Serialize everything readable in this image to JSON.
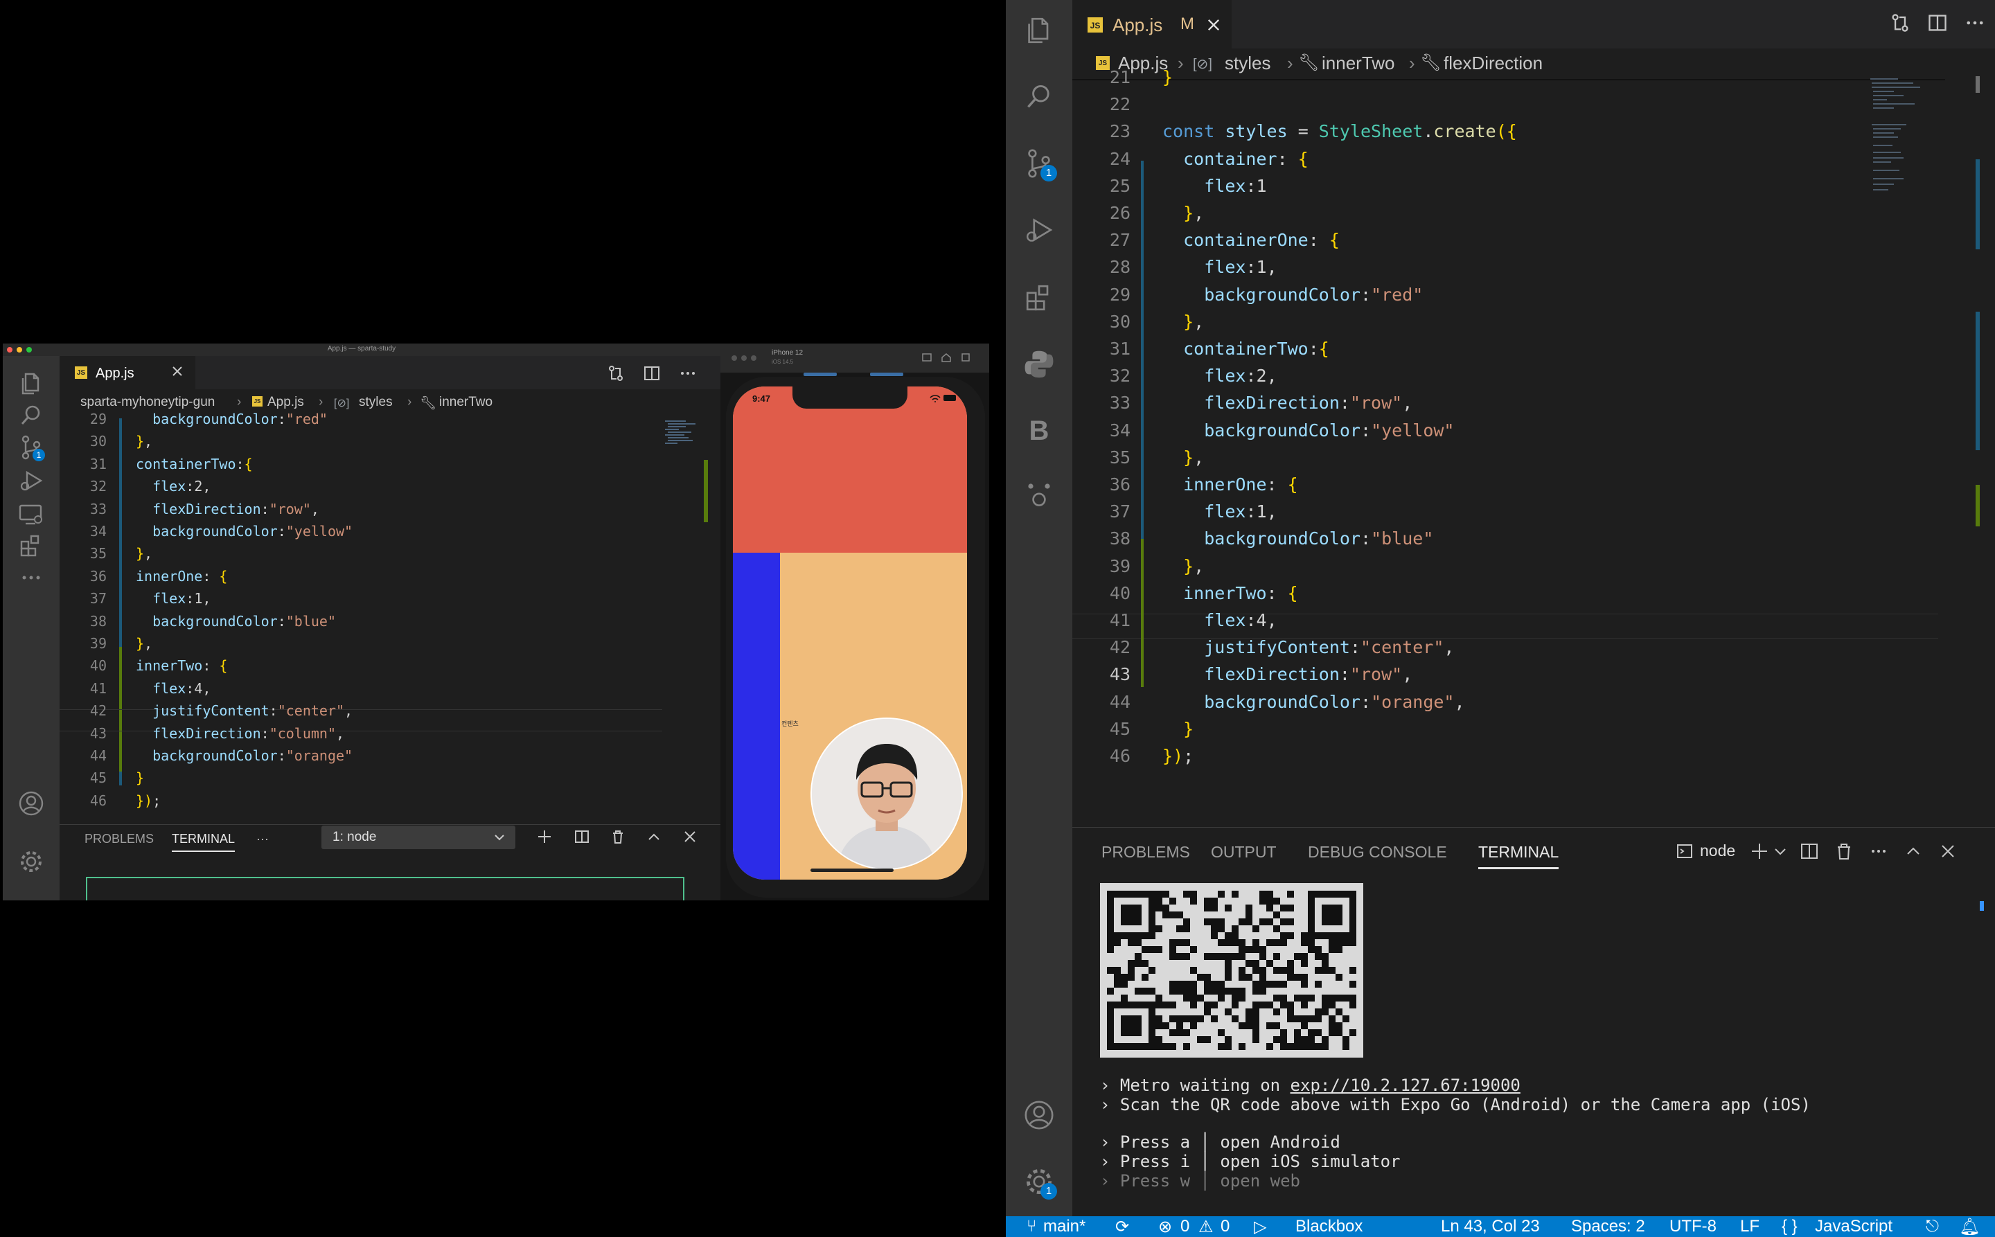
{
  "left_window": {
    "title": "App.js — sparta-study",
    "tab_label": "App.js",
    "breadcrumb": [
      "sparta-myhoneytip-gun",
      "App.js",
      "styles",
      "innerTwo"
    ],
    "code_lines": [
      {
        "n": "29",
        "t": "  backgroundColor:\"red\""
      },
      {
        "n": "30",
        "t": "},"
      },
      {
        "n": "31",
        "t": "containerTwo:{"
      },
      {
        "n": "32",
        "t": "  flex:2,"
      },
      {
        "n": "33",
        "t": "  flexDirection:\"row\","
      },
      {
        "n": "34",
        "t": "  backgroundColor:\"yellow\""
      },
      {
        "n": "35",
        "t": "},"
      },
      {
        "n": "36",
        "t": "innerOne: {"
      },
      {
        "n": "37",
        "t": "  flex:1,"
      },
      {
        "n": "38",
        "t": "  backgroundColor:\"blue\""
      },
      {
        "n": "39",
        "t": "},"
      },
      {
        "n": "40",
        "t": "innerTwo: {"
      },
      {
        "n": "41",
        "t": "  flex:4,"
      },
      {
        "n": "42",
        "t": "  justifyContent:\"center\","
      },
      {
        "n": "43",
        "t": "  flexDirection:\"column\","
      },
      {
        "n": "44",
        "t": "  backgroundColor:\"orange\""
      },
      {
        "n": "45",
        "t": "}"
      },
      {
        "n": "46",
        "t": "});"
      }
    ],
    "panel_tabs": {
      "problems": "PROBLEMS",
      "terminal": "TERMINAL",
      "more": "···"
    },
    "terminal_select": "1: node",
    "source_control_badge": "1"
  },
  "simulator": {
    "device": "iPhone 12",
    "os": "iOS 14.5",
    "time": "9:47",
    "text": "컨텐츠",
    "colors": {
      "top": "#e05c4a",
      "left": "#2c2ce8",
      "right": "#f0bc7b"
    }
  },
  "right_window": {
    "tab_label": "App.js",
    "tab_modified": "M",
    "breadcrumb": [
      "App.js",
      "styles",
      "innerTwo",
      "flexDirection"
    ],
    "code_lines": [
      {
        "n": "21",
        "t": "}"
      },
      {
        "n": "22",
        "t": ""
      },
      {
        "n": "23",
        "t": "const styles = StyleSheet.create({"
      },
      {
        "n": "24",
        "t": "  container: {"
      },
      {
        "n": "25",
        "t": "    flex:1"
      },
      {
        "n": "26",
        "t": "  },"
      },
      {
        "n": "27",
        "t": "  containerOne: {"
      },
      {
        "n": "28",
        "t": "    flex:1,"
      },
      {
        "n": "29",
        "t": "    backgroundColor:\"red\""
      },
      {
        "n": "30",
        "t": "  },"
      },
      {
        "n": "31",
        "t": "  containerTwo:{"
      },
      {
        "n": "32",
        "t": "    flex:2,"
      },
      {
        "n": "33",
        "t": "    flexDirection:\"row\","
      },
      {
        "n": "34",
        "t": "    backgroundColor:\"yellow\""
      },
      {
        "n": "35",
        "t": "  },"
      },
      {
        "n": "36",
        "t": "  innerOne: {"
      },
      {
        "n": "37",
        "t": "    flex:1,"
      },
      {
        "n": "38",
        "t": "    backgroundColor:\"blue\""
      },
      {
        "n": "39",
        "t": "  },"
      },
      {
        "n": "40",
        "t": "  innerTwo: {"
      },
      {
        "n": "41",
        "t": "    flex:4,"
      },
      {
        "n": "42",
        "t": "    justifyContent:\"center\","
      },
      {
        "n": "43",
        "t": "    flexDirection:\"row\","
      },
      {
        "n": "44",
        "t": "    backgroundColor:\"orange\","
      },
      {
        "n": "45",
        "t": "  }"
      },
      {
        "n": "46",
        "t": "});"
      }
    ],
    "active_line": "43",
    "panel_tabs": {
      "problems": "PROBLEMS",
      "output": "OUTPUT",
      "debug": "DEBUG CONSOLE",
      "terminal": "TERMINAL"
    },
    "terminal_name": "node",
    "terminal_lines": {
      "metro_prefix": "› Metro waiting on ",
      "metro_url": "exp://10.2.127.67:19000",
      "scan": "› Scan the QR code above with Expo Go (Android) or the Camera app (iOS)",
      "press_a_key": "› Press a",
      "press_a_action": "open Android",
      "press_i_key": "› Press i",
      "press_i_action": "open iOS simulator",
      "press_w_key": "› Press w",
      "press_w_action": "open web"
    },
    "activity_badge_scm": "1",
    "activity_badge_settings": "1",
    "activity_b_label": "B",
    "status_bar": {
      "branch": "main*",
      "errors": "0",
      "warnings": "0",
      "blackbox": "Blackbox",
      "position": "Ln 43, Col 23",
      "spaces": "Spaces: 2",
      "encoding": "UTF-8",
      "eol": "LF",
      "language_prefix": "{ }",
      "language": "JavaScript"
    }
  }
}
